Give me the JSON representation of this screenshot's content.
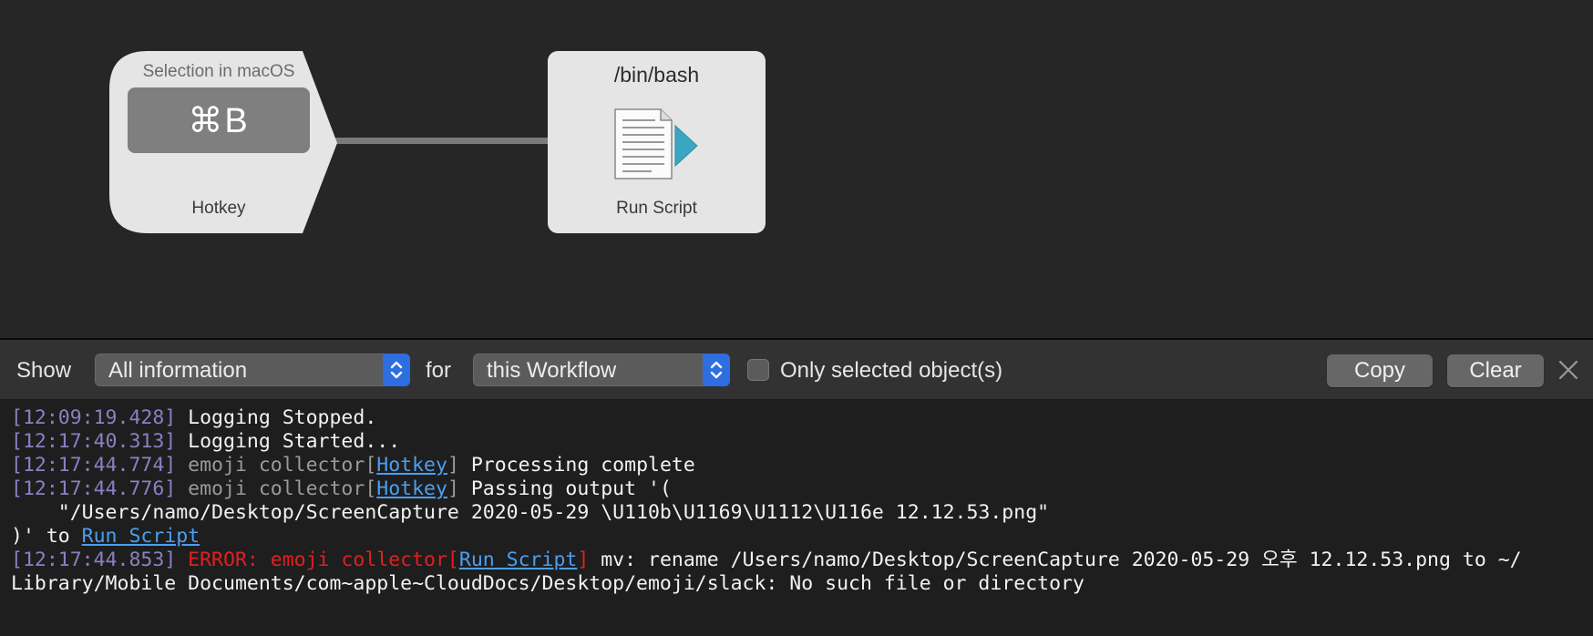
{
  "canvas": {
    "hotkey_node": {
      "title": "Selection in macOS",
      "key": "⌘B",
      "label": "Hotkey"
    },
    "script_node": {
      "title": "/bin/bash",
      "label": "Run Script",
      "icon": "script-document-icon"
    }
  },
  "toolbar": {
    "show_label": "Show",
    "show_select": "All information",
    "for_label": "for",
    "for_select": "this Workflow",
    "checkbox_label": "Only selected object(s)",
    "checkbox_checked": false,
    "copy_label": "Copy",
    "clear_label": "Clear",
    "close_icon": "close-icon"
  },
  "log": [
    {
      "ts": "[12:09:19.428]",
      "msg": " Logging Stopped."
    },
    {
      "ts": "[12:17:40.313]",
      "msg": " Logging Started..."
    },
    {
      "ts": "[12:17:44.774]",
      "src": " emoji collector[",
      "link": "Hotkey",
      "src_end": "]",
      "msg": " Processing complete"
    },
    {
      "ts": "[12:17:44.776]",
      "src": " emoji collector[",
      "link": "Hotkey",
      "src_end": "]",
      "msg": " Passing output '("
    },
    {
      "msg": "    \"/Users/namo/Desktop/ScreenCapture 2020-05-29 \\U110b\\U1169\\U1112\\U116e 12.12.53.png\""
    },
    {
      "msg": ")' to ",
      "link": "Run Script"
    },
    {
      "ts": "[12:17:44.853]",
      "err": " ERROR: emoji collector[",
      "link": "Run Script",
      "err_end": "]",
      "msg": " mv: rename /Users/namo/Desktop/ScreenCapture 2020-05-29 오후 12.12.53.png to ~/"
    },
    {
      "msg": "Library/Mobile Documents/com~apple~CloudDocs/Desktop/emoji/slack: No such file or directory"
    }
  ],
  "colors": {
    "timestamp": "#8d7fc4",
    "link": "#4a9ff2",
    "error": "#e02020",
    "accent": "#2d6ee0"
  }
}
